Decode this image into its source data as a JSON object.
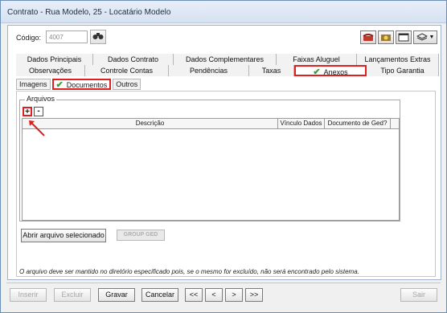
{
  "window": {
    "title": "Contrato - Rua Modelo, 25 - Locatário Modelo"
  },
  "header": {
    "code_label": "Código:",
    "code_value": "4007"
  },
  "tabs_row1": [
    "Dados Principais",
    "Dados Contrato",
    "Dados Complementares",
    "Faixas Aluguel",
    "Lançamentos Extras"
  ],
  "tabs_row2": [
    "Observações",
    "Controle Contas",
    "Pendências",
    "Taxas",
    "Anexos",
    "Tipo Garantia"
  ],
  "subtabs": [
    "Imagens",
    "Documentos",
    "Outros"
  ],
  "arquivos": {
    "legend": "Arquivos",
    "add_label": "+",
    "remove_label": "-",
    "columns": [
      "Descrição",
      "Vínculo Dados",
      "Documento de Ged?"
    ]
  },
  "actions": {
    "open_file": "Abrir arquivo selecionado",
    "group_ged": "GROUP GED"
  },
  "note": "O arquivo deve ser mantido no diretório especificado pois, se o mesmo for excluído, não será encontrado pelo sistema.",
  "footer": {
    "inserir": "Inserir",
    "excluir": "Excluir",
    "gravar": "Gravar",
    "cancelar": "Cancelar",
    "first": "<<",
    "prev": "<",
    "next": ">",
    "last": ">>",
    "sair": "Sair"
  },
  "colors": {
    "highlight": "#e02020",
    "check": "#2ba52b"
  }
}
